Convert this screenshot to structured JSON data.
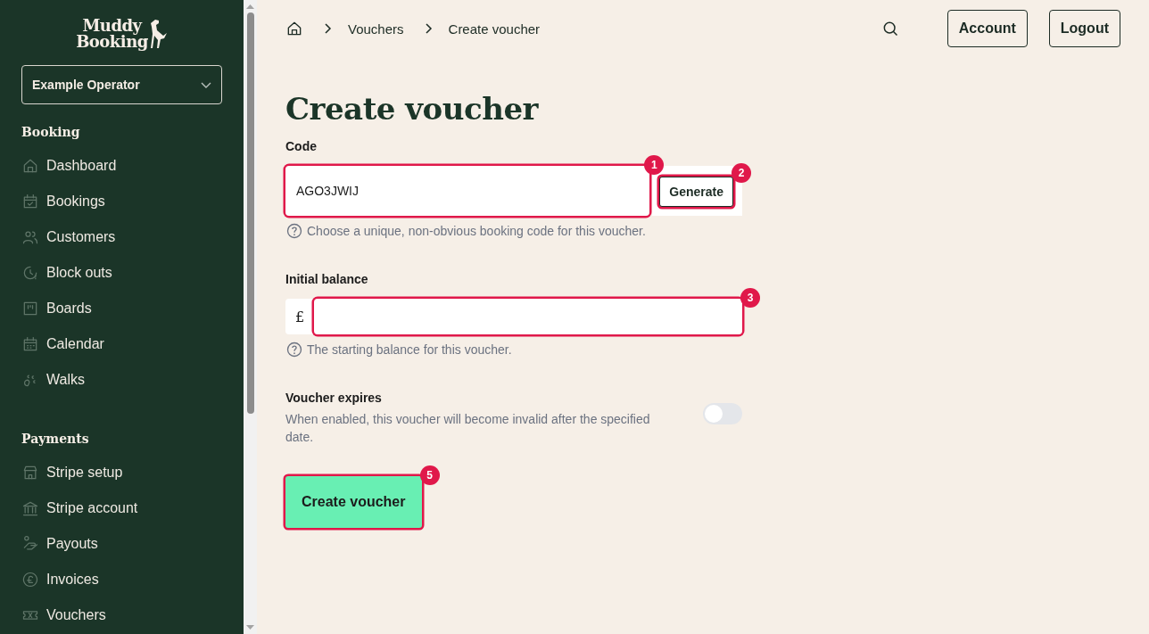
{
  "sidebar": {
    "logo": [
      "Muddy",
      "Booking"
    ],
    "operator_select": {
      "value": "Example Operator"
    },
    "sections": [
      {
        "heading": "Booking",
        "items": [
          {
            "label": "Dashboard"
          },
          {
            "label": "Bookings"
          },
          {
            "label": "Customers"
          },
          {
            "label": "Block outs"
          },
          {
            "label": "Boards"
          },
          {
            "label": "Calendar"
          },
          {
            "label": "Walks"
          }
        ]
      },
      {
        "heading": "Payments",
        "items": [
          {
            "label": "Stripe setup"
          },
          {
            "label": "Stripe account"
          },
          {
            "label": "Payouts"
          },
          {
            "label": "Invoices"
          },
          {
            "label": "Vouchers"
          }
        ]
      }
    ]
  },
  "breadcrumbs": [
    "Vouchers",
    "Create voucher"
  ],
  "header_buttons": [
    "Account",
    "Logout"
  ],
  "title": "Create voucher",
  "code": {
    "label": "Code",
    "value": "AGO3JWIJ",
    "marker": "1",
    "generate": {
      "label": "Generate",
      "marker": "2"
    },
    "help": "Choose a unique, non-obvious booking code for this voucher."
  },
  "balance": {
    "label": "Initial balance",
    "prefix": "£",
    "marker": "3",
    "help": "The starting balance for this voucher."
  },
  "expires": {
    "label": "Voucher expires",
    "description": "When enabled, this voucher will become invalid after the specified date.",
    "on": false
  },
  "submit": {
    "label": "Create voucher",
    "marker": "5"
  }
}
